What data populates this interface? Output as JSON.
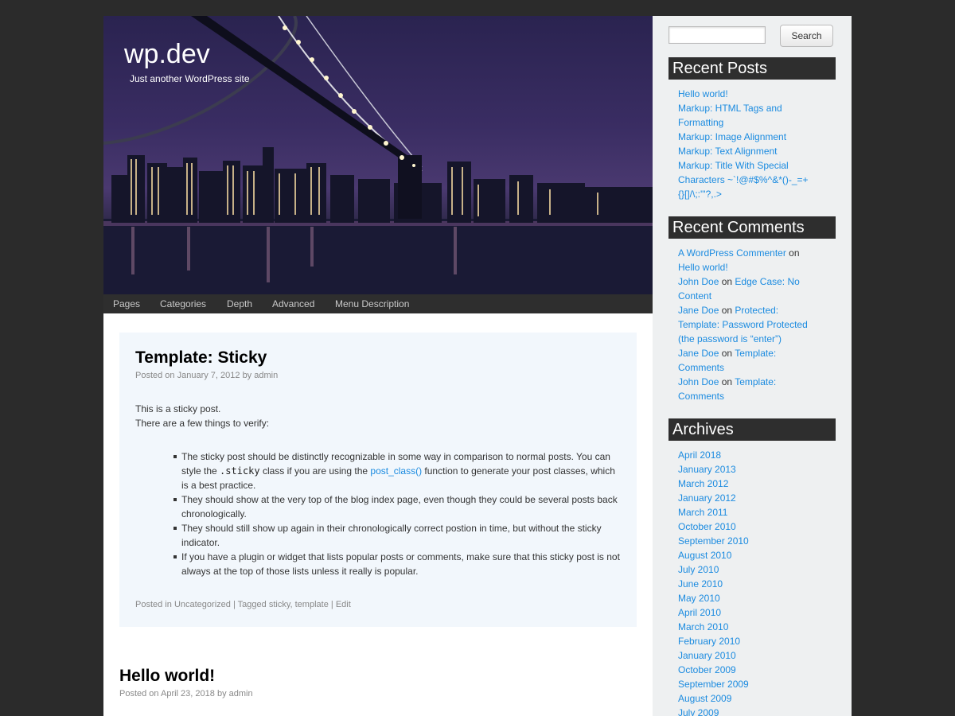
{
  "site": {
    "title": "wp.dev",
    "description": "Just another WordPress site"
  },
  "nav": {
    "items": [
      "Pages",
      "Categories",
      "Depth",
      "Advanced",
      "Menu Description"
    ]
  },
  "sticky_post": {
    "title": "Template: Sticky",
    "meta_prefix": "Posted on",
    "date": "January 7, 2012",
    "by": "by",
    "author": "admin",
    "para1": "This is a sticky post.",
    "para2": "There are a few things to verify:",
    "bullet1_a": "The sticky post should be distinctly recognizable in some way in comparison to normal posts. You can style the",
    "bullet1_code": ".sticky",
    "bullet1_b": "class if you are using the",
    "bullet1_link": "post_class()",
    "bullet1_c": "function to generate your post classes, which is a best practice.",
    "bullet2": "They should show at the very top of the blog index page, even though they could be several posts back chronologically.",
    "bullet3": "They should still show up again in their chronologically correct postion in time, but without the sticky indicator.",
    "bullet4": "If you have a plugin or widget that lists popular posts or comments, make sure that this sticky post is not always at the top of those lists unless it really is popular.",
    "footer_posted_in": "Posted in",
    "footer_category": "Uncategorized",
    "footer_sep1": "|",
    "footer_tagged": "Tagged",
    "footer_tag1": "sticky",
    "footer_comma": ",",
    "footer_tag2": "template",
    "footer_sep2": "|",
    "footer_edit": "Edit"
  },
  "second_post": {
    "title": "Hello world!",
    "meta_prefix": "Posted on",
    "date": "April 23, 2018",
    "by": "by",
    "author": "admin"
  },
  "sidebar": {
    "search_button": "Search",
    "recent_posts_title": "Recent Posts",
    "recent_posts": [
      "Hello world!",
      "Markup: HTML Tags and",
      "Formatting",
      "Markup: Image Alignment",
      "Markup: Text Alignment",
      "Markup: Title With Special",
      "Characters ~`!@#$%^&*()-_=+",
      "{}[]/\\;:'\"?,.>"
    ],
    "recent_comments_title": "Recent Comments",
    "comments": [
      {
        "author": "A WordPress Commenter",
        "on": "on",
        "post": "Hello world!"
      },
      {
        "author": "John Doe",
        "on": "on",
        "post": "Edge Case: No Content"
      },
      {
        "author": "Jane Doe",
        "on": "on",
        "post": "Protected: Template: Password Protected (the password is “enter”)"
      },
      {
        "author": "Jane Doe",
        "on": "on",
        "post": "Template: Comments"
      },
      {
        "author": "John Doe",
        "on": "on",
        "post": "Template: Comments"
      }
    ],
    "archives_title": "Archives",
    "archives": [
      "April 2018",
      "January 2013",
      "March 2012",
      "January 2012",
      "March 2011",
      "October 2010",
      "September 2010",
      "August 2010",
      "July 2010",
      "June 2010",
      "May 2010",
      "April 2010",
      "March 2010",
      "February 2010",
      "January 2010",
      "October 2009",
      "September 2009",
      "August 2009",
      "July 2009"
    ]
  }
}
